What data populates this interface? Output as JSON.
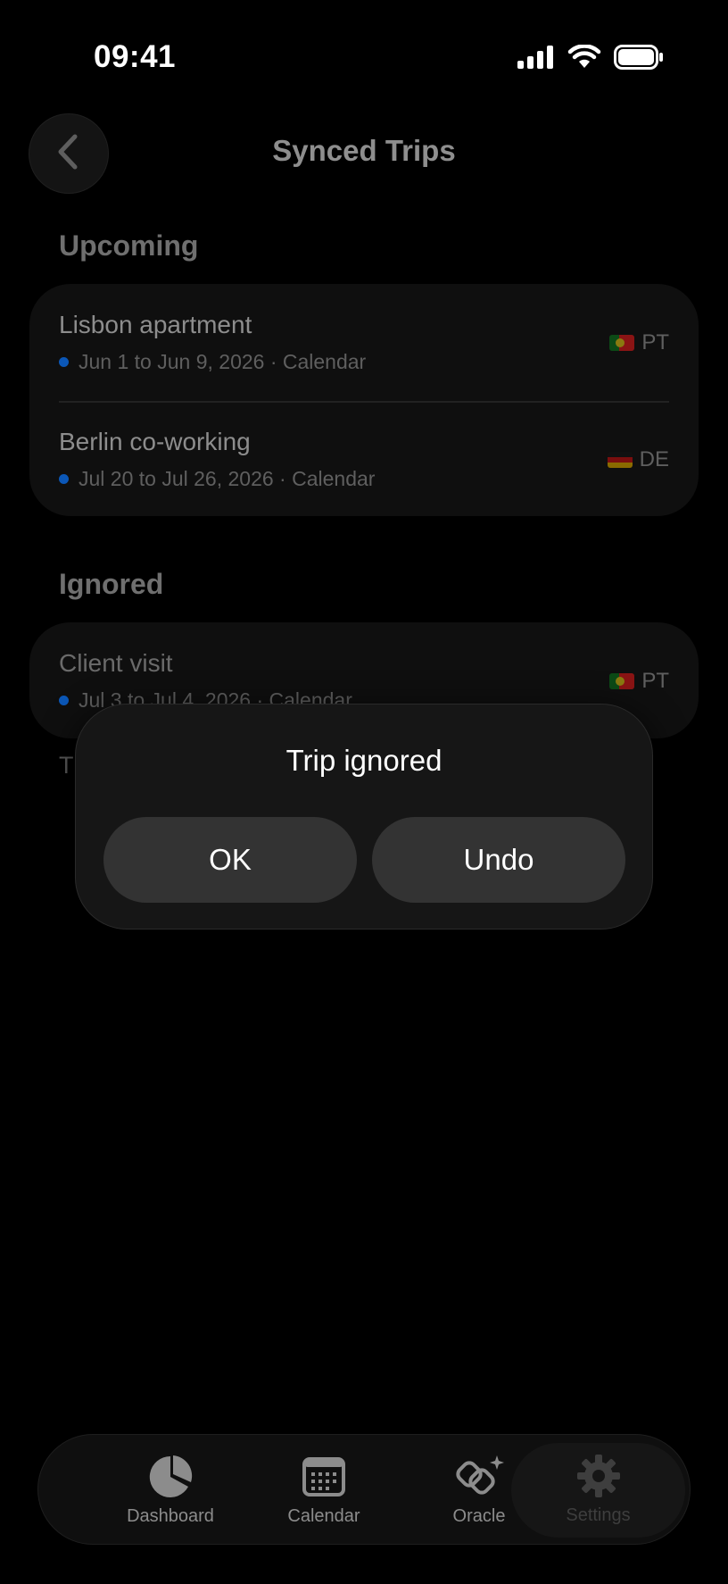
{
  "status_bar": {
    "time": "09:41",
    "icons": [
      "cellular-signal-icon",
      "wifi-icon",
      "battery-icon"
    ]
  },
  "nav": {
    "back_icon": "chevron-left-icon",
    "title": "Synced Trips"
  },
  "upcoming": {
    "title": "Upcoming",
    "trips": [
      {
        "title": "Lisbon apartment",
        "dates": "Jun 1 to Jun 9, 2026 · Calendar",
        "country": "PT",
        "flag": "portugal-flag"
      },
      {
        "title": "Berlin co-working",
        "dates": "Jul 20 to Jul 26, 2026 · Calendar",
        "country": "DE",
        "flag": "germany-flag"
      }
    ]
  },
  "ignored": {
    "title": "Ignored",
    "trips": [
      {
        "title": "Client visit",
        "dates": "Jul 3 to Jul 4, 2026 · Calendar",
        "country": "PT",
        "flag": "portugal-flag"
      }
    ],
    "footer_partial": "T"
  },
  "alert": {
    "title": "Trip ignored",
    "ok_label": "OK",
    "undo_label": "Undo"
  },
  "tabbar": {
    "tabs": [
      {
        "label": "Dashboard",
        "icon": "pie-chart-icon"
      },
      {
        "label": "Calendar",
        "icon": "calendar-icon"
      },
      {
        "label": "Oracle",
        "icon": "oracle-sparkle-icon"
      },
      {
        "label": "Settings",
        "icon": "gear-icon",
        "selected": true
      }
    ]
  },
  "colors": {
    "background": "#000000",
    "card": "#0f0f0f",
    "dot_accent": "#0b57b7",
    "alert_button": "#333333"
  }
}
